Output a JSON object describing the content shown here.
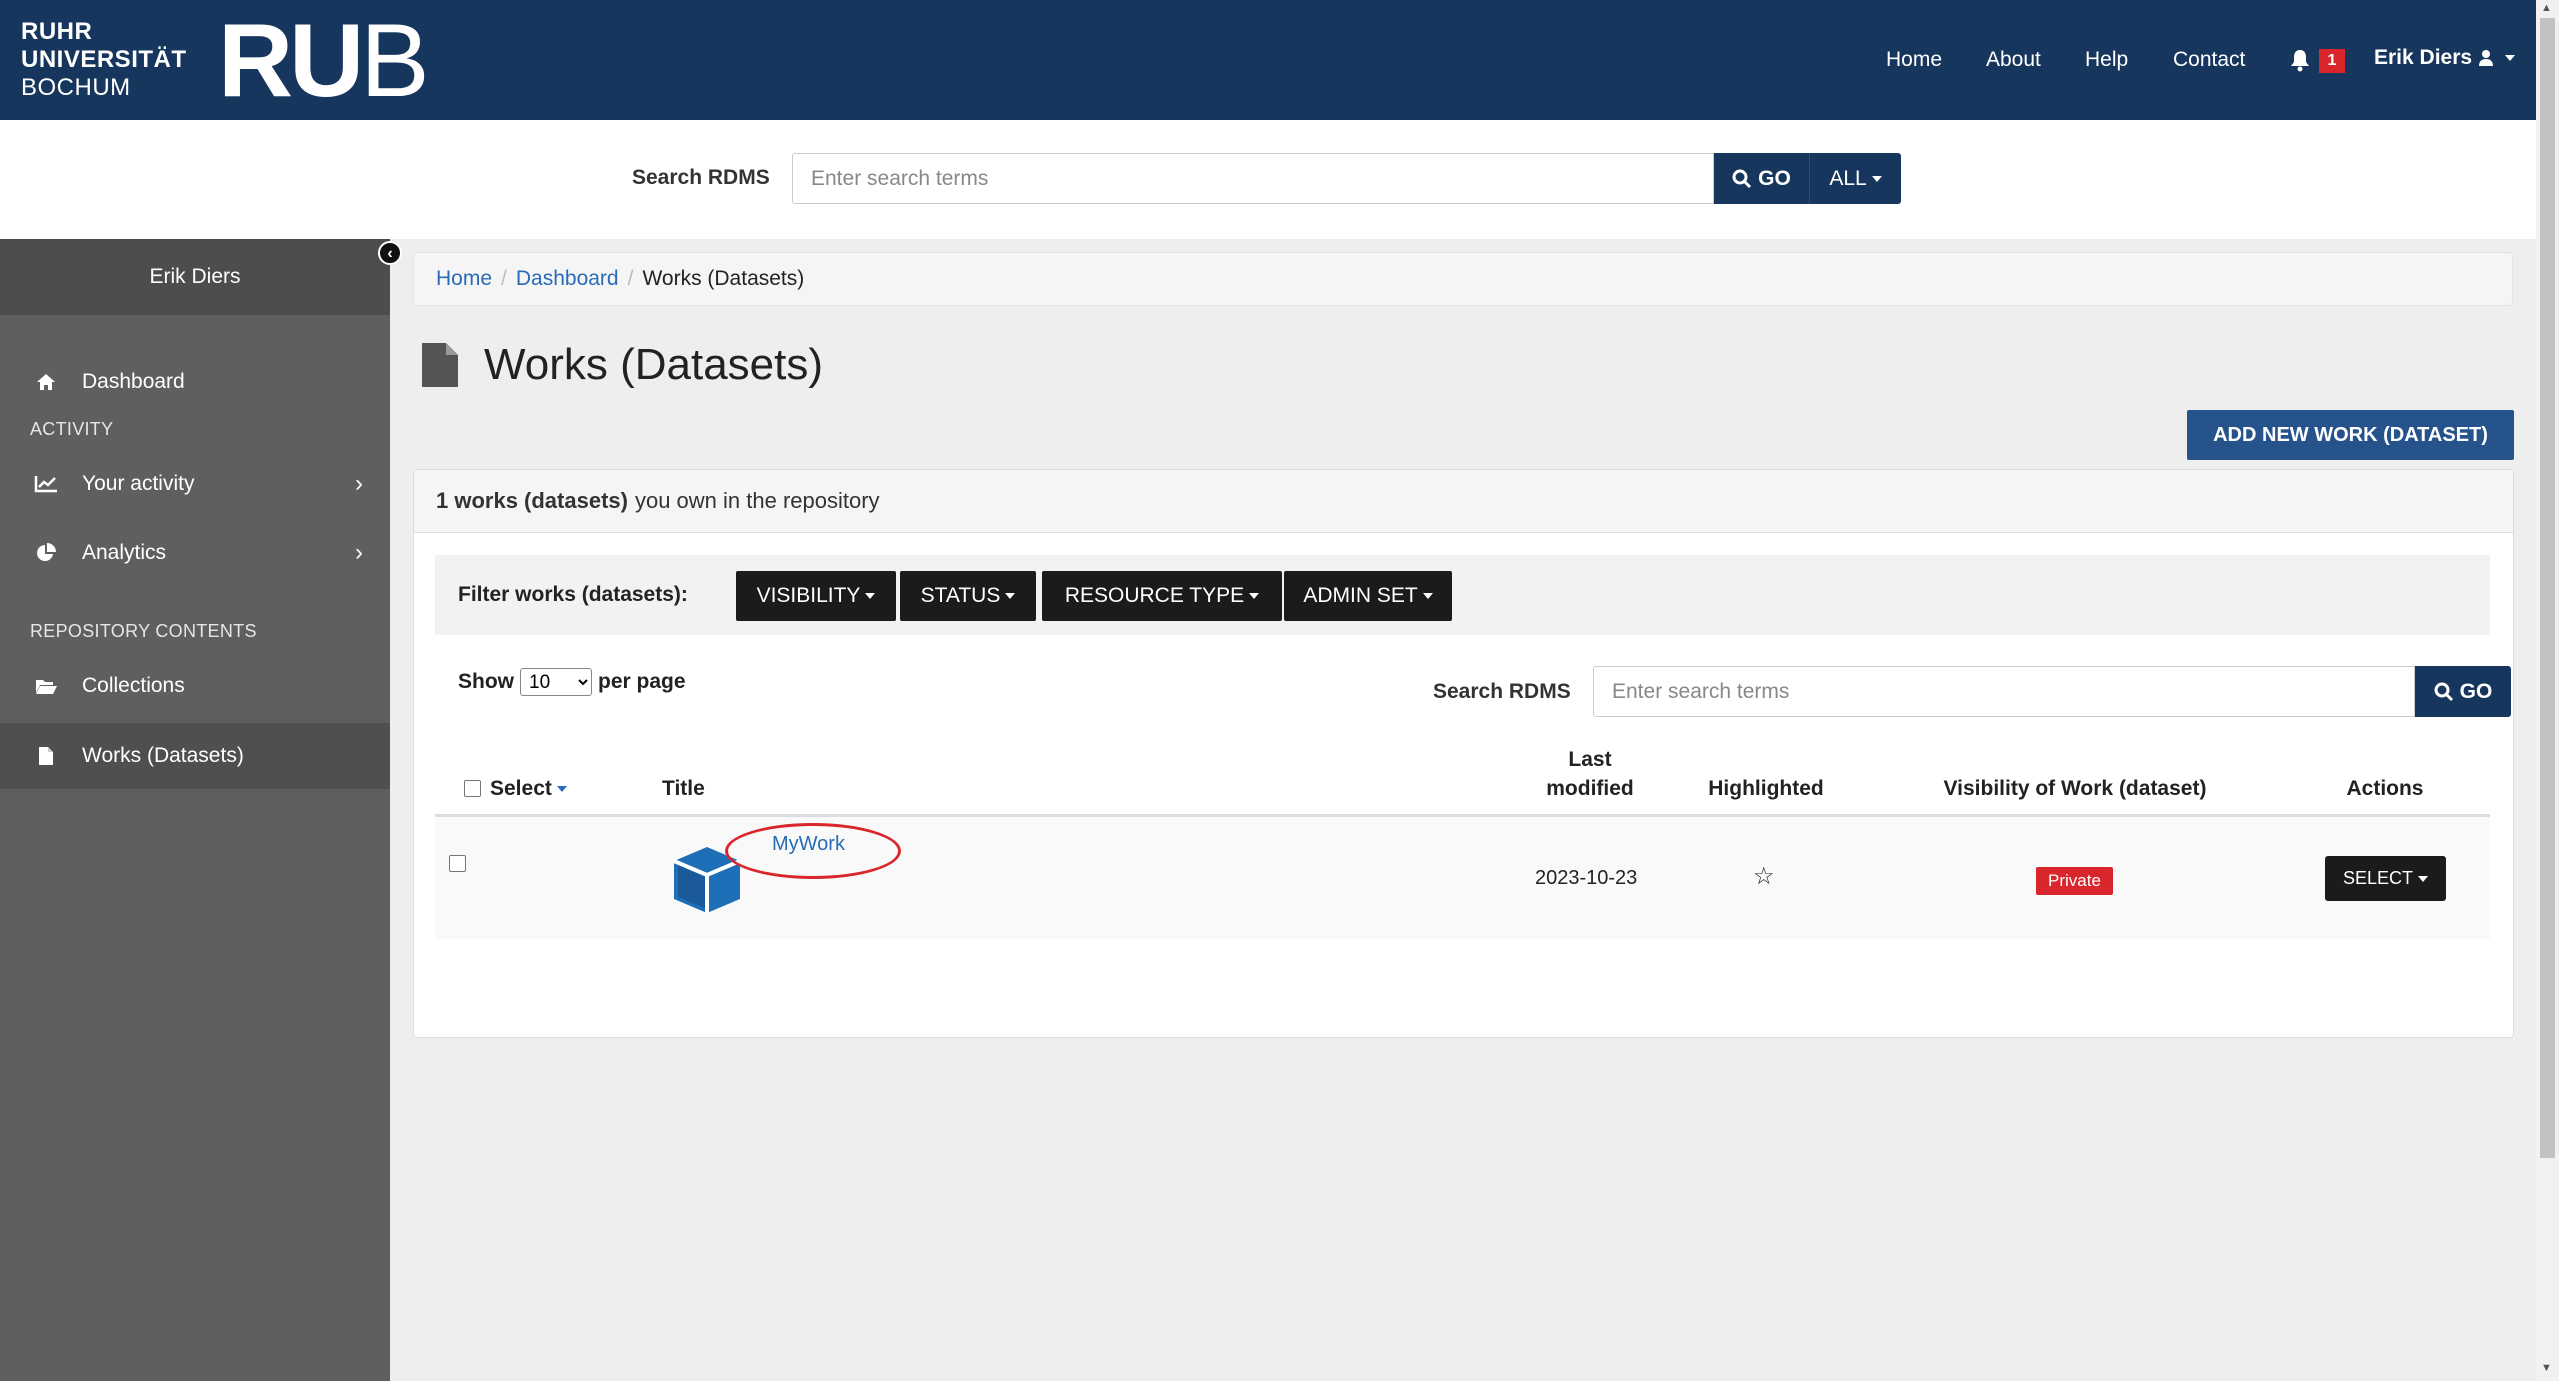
{
  "header": {
    "logo_lines": [
      "RUHR",
      "UNIVERSITÄT",
      "BOCHUM"
    ],
    "logo_mark_bold": "RU",
    "logo_mark_light": "B",
    "nav": [
      "Home",
      "About",
      "Help",
      "Contact"
    ],
    "notification_count": "1",
    "user_name": "Erik Diers",
    "bg_color": "#17365d"
  },
  "top_search": {
    "label": "Search RDMS",
    "placeholder": "Enter search terms",
    "go_label": "GO",
    "scope_label": "ALL"
  },
  "sidebar": {
    "user": "Erik Diers",
    "dashboard": "Dashboard",
    "activity_heading": "ACTIVITY",
    "your_activity": "Your activity",
    "analytics": "Analytics",
    "repo_heading": "REPOSITORY CONTENTS",
    "collections": "Collections",
    "works": "Works (Datasets)"
  },
  "breadcrumb": [
    "Home",
    "Dashboard",
    "Works (Datasets)"
  ],
  "page": {
    "title": "Works (Datasets)",
    "add_button": "ADD NEW WORK (DATASET)",
    "summary_bold": "1 works (datasets)",
    "summary_rest": "you own in the repository"
  },
  "filters": {
    "label": "Filter works (datasets):",
    "buttons": [
      "VISIBILITY",
      "STATUS",
      "RESOURCE TYPE",
      "ADMIN SET"
    ]
  },
  "list_controls": {
    "show_label": "Show",
    "per_page_value": "10",
    "per_page_label": "per page",
    "search_label": "Search RDMS",
    "search_placeholder": "Enter search terms",
    "go_label": "GO"
  },
  "table": {
    "headers": {
      "select": "Select",
      "title": "Title",
      "last_modified_1": "Last",
      "last_modified_2": "modified",
      "highlighted": "Highlighted",
      "visibility": "Visibility of Work (dataset)",
      "actions": "Actions"
    },
    "rows": [
      {
        "title": "MyWork",
        "last_modified": "2023-10-23",
        "highlighted": "☆",
        "visibility": "Private",
        "action": "SELECT"
      }
    ]
  },
  "colors": {
    "accent": "#17365d",
    "link": "#2a6bb5",
    "private_badge": "#d9262c",
    "annotation_circle": "#d9262c"
  }
}
